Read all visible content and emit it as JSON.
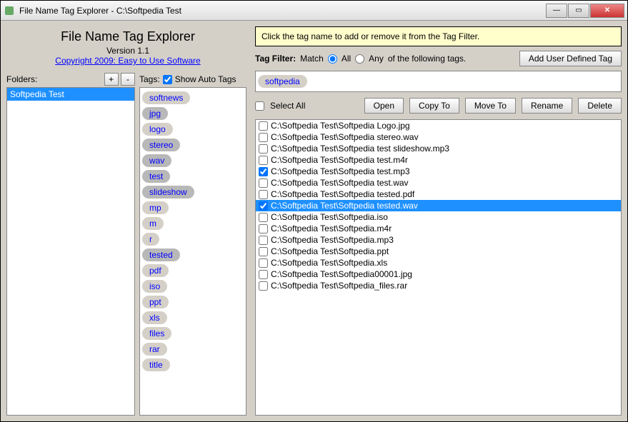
{
  "window": {
    "title": "File Name Tag Explorer - C:\\Softpedia Test"
  },
  "header": {
    "app_title": "File Name Tag Explorer",
    "version": "Version 1.1",
    "copyright": "Copyright 2009: Easy to Use Software"
  },
  "folders": {
    "label": "Folders:",
    "add": "+",
    "remove": "-",
    "items": [
      "Softpedia Test"
    ]
  },
  "tags": {
    "label": "Tags:",
    "show_auto_label": "Show Auto Tags",
    "items": [
      "softnews",
      "jpg",
      "logo",
      "stereo",
      "wav",
      "test",
      "slideshow",
      "mp",
      "m",
      "r",
      "tested",
      "pdf",
      "iso",
      "ppt",
      "xls",
      "files",
      "rar",
      "title"
    ],
    "selected": [
      "jpg",
      "stereo",
      "wav",
      "test",
      "slideshow",
      "tested"
    ]
  },
  "hint": "Click the tag name to add or remove it from the Tag Filter.",
  "filter": {
    "label": "Tag Filter:",
    "match_label": "Match",
    "opt_all": "All",
    "opt_any": "Any",
    "suffix": "of the following tags.",
    "add_user_btn": "Add User Defined Tag",
    "active_tags": [
      "softpedia"
    ]
  },
  "files": {
    "select_all": "Select All",
    "open": "Open",
    "copy_to": "Copy To",
    "move_to": "Move To",
    "rename": "Rename",
    "delete": "Delete",
    "items": [
      {
        "path": "C:\\Softpedia Test\\Softpedia Logo.jpg",
        "checked": false,
        "selected": false
      },
      {
        "path": "C:\\Softpedia Test\\Softpedia stereo.wav",
        "checked": false,
        "selected": false
      },
      {
        "path": "C:\\Softpedia Test\\Softpedia test slideshow.mp3",
        "checked": false,
        "selected": false
      },
      {
        "path": "C:\\Softpedia Test\\Softpedia test.m4r",
        "checked": false,
        "selected": false
      },
      {
        "path": "C:\\Softpedia Test\\Softpedia test.mp3",
        "checked": true,
        "selected": false
      },
      {
        "path": "C:\\Softpedia Test\\Softpedia test.wav",
        "checked": false,
        "selected": false
      },
      {
        "path": "C:\\Softpedia Test\\Softpedia tested.pdf",
        "checked": false,
        "selected": false
      },
      {
        "path": "C:\\Softpedia Test\\Softpedia tested.wav",
        "checked": true,
        "selected": true
      },
      {
        "path": "C:\\Softpedia Test\\Softpedia.iso",
        "checked": false,
        "selected": false
      },
      {
        "path": "C:\\Softpedia Test\\Softpedia.m4r",
        "checked": false,
        "selected": false
      },
      {
        "path": "C:\\Softpedia Test\\Softpedia.mp3",
        "checked": false,
        "selected": false
      },
      {
        "path": "C:\\Softpedia Test\\Softpedia.ppt",
        "checked": false,
        "selected": false
      },
      {
        "path": "C:\\Softpedia Test\\Softpedia.xls",
        "checked": false,
        "selected": false
      },
      {
        "path": "C:\\Softpedia Test\\Softpedia00001.jpg",
        "checked": false,
        "selected": false
      },
      {
        "path": "C:\\Softpedia Test\\Softpedia_files.rar",
        "checked": false,
        "selected": false
      }
    ]
  }
}
